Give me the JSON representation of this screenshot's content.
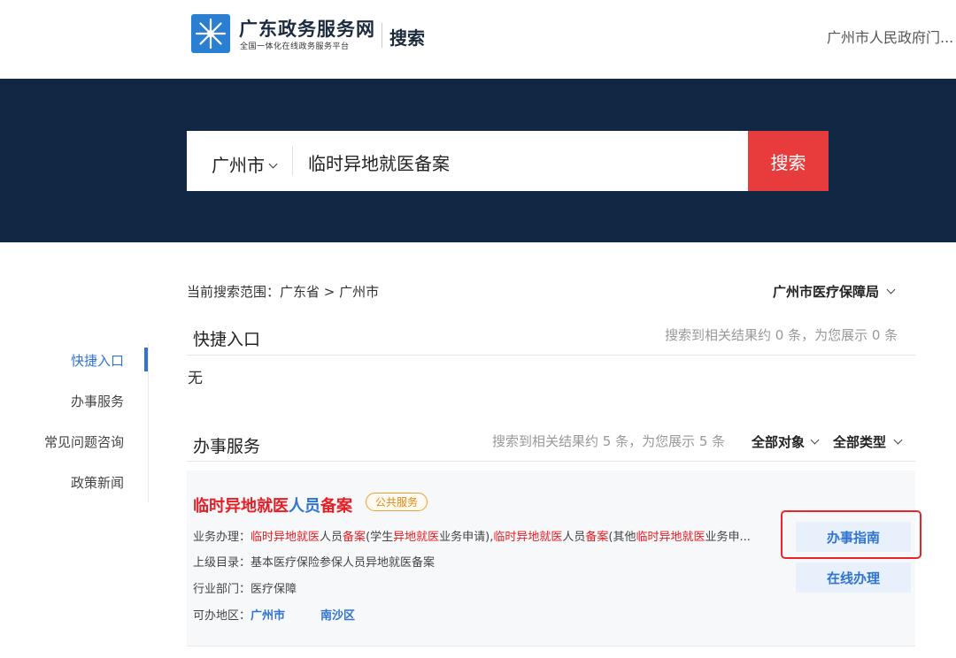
{
  "header": {
    "brand_name": "广东政务服务网",
    "brand_subtitle": "全国一体化在线政务服务平台",
    "section": "搜索",
    "gov_link": "广州市人民政府门..."
  },
  "search": {
    "city": "广州市",
    "query": "临时异地就医备案",
    "button_label": "搜索"
  },
  "nav": {
    "items": [
      {
        "label": "快捷入口",
        "active": true
      },
      {
        "label": "办事服务",
        "active": false
      },
      {
        "label": "常见问题咨询",
        "active": false
      },
      {
        "label": "政策新闻",
        "active": false
      }
    ]
  },
  "scope": {
    "text": "当前搜索范围：广东省 > 广州市",
    "department": "广州市医疗保障局"
  },
  "quick_entry": {
    "title": "快捷入口",
    "count_text": "搜索到相关结果约 0 条，为您展示 0 条",
    "empty_text": "无"
  },
  "services": {
    "title": "办事服务",
    "count_text": "搜索到相关结果约 5 条，为您展示 5 条",
    "filter_object": "全部对象",
    "filter_type": "全部类型",
    "result": {
      "title_parts": [
        "临时异地就医",
        "人员",
        "备案"
      ],
      "tag": "公共服务",
      "biz_label": "业务办理：",
      "biz_parts": [
        "临时异地就医",
        "人员",
        "备案",
        "(学生",
        "异地就医",
        "业务申请),",
        "临时异地就医",
        "人员",
        "备案",
        "(其他",
        "临时异地就医",
        "业务申..."
      ],
      "parent_label": "上级目录：",
      "parent_value": "基本医疗保险参保人员异地就医备案",
      "dept_label": "行业部门：",
      "dept_value": "医疗保障",
      "area_label": "可办地区：",
      "areas": [
        "广州市",
        "南沙区"
      ],
      "guide_button": "办事指南",
      "online_button": "在线办理"
    }
  },
  "colors": {
    "header_bg": "#112844",
    "search_button": "#e83b3b",
    "accent_blue": "#2f74d0",
    "highlight_red": "#e31e24"
  }
}
